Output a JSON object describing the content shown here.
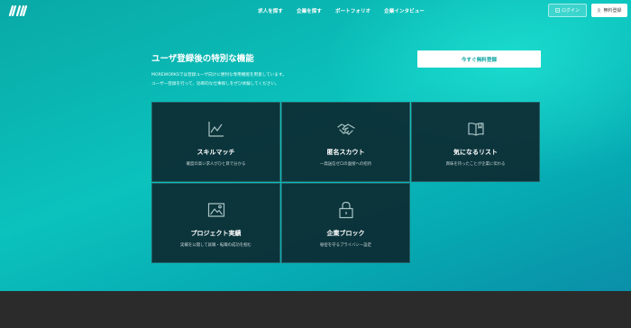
{
  "header": {
    "logo_icon": "mw-logo-icon",
    "nav": [
      "求人を探す",
      "企業を探す",
      "ポートフォリオ",
      "企業インタビュー"
    ],
    "login_label": "ログイン",
    "register_label": "無料登録"
  },
  "intro": {
    "title": "ユーザ登録後の特別な機能",
    "desc_line1": "MOREWORKSでは登録ユーザ向けに便利な専用機能を用意しています。",
    "desc_line2": "ユーザー登録を行って、効率的な仕事探しをぜひ体験してください。",
    "cta_label": "今すぐ無料登録"
  },
  "cards": [
    {
      "icon": "chart-icon",
      "title": "スキルマッチ",
      "desc": "確度の高い求人がひと目で分かる"
    },
    {
      "icon": "handshake-icon",
      "title": "匿名スカウト",
      "desc": "一発送信ゼロの面接への招待"
    },
    {
      "icon": "book-icon",
      "title": "気になるリスト",
      "desc": "興味を持ったことが企業に伝わる"
    },
    {
      "icon": "image-icon",
      "title": "プロジェクト実績",
      "desc": "実績を公開して就職・転職の成功を掴む"
    },
    {
      "icon": "lock-icon",
      "title": "企業ブロック",
      "desc": "秘密を守るプライバシー設定"
    }
  ],
  "colors": {
    "accent": "#0bc2bd",
    "card_bg": "#0c2a32",
    "footer": "#2b2b2b"
  }
}
